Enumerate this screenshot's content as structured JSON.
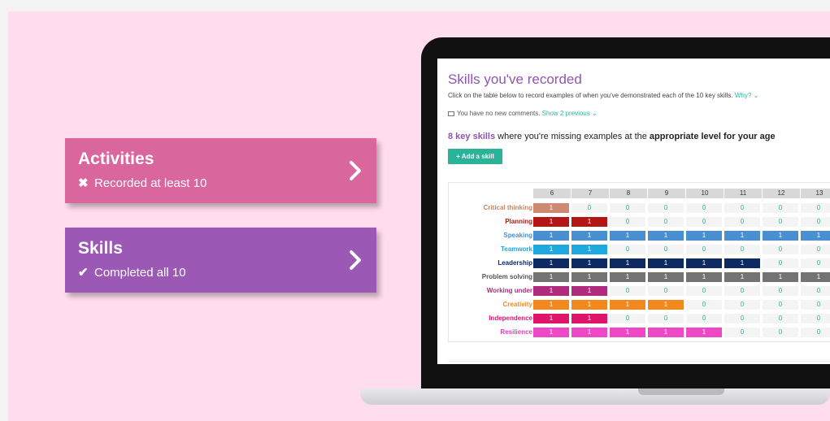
{
  "cards": {
    "activities": {
      "title": "Activities",
      "mark": "✖",
      "subtitle": "Recorded at least 10"
    },
    "skills": {
      "title": "Skills",
      "mark": "✔",
      "subtitle": "Completed all 10"
    }
  },
  "app": {
    "title": "Skills you've recorded",
    "description": "Click on the table below to record examples of when you've demonstrated each of the 10 key skills.",
    "why_link": "Why? ⌄",
    "comments_text": "You have no new comments.",
    "show_previous": "Show 2 previous ⌄",
    "missing_count": "8 key skills",
    "missing_mid": "where you're missing examples at the",
    "missing_bold": "appropriate level for your age",
    "add_button": "+ Add a skill"
  },
  "table": {
    "columns": [
      "6",
      "7",
      "8",
      "9",
      "10",
      "11",
      "12",
      "13"
    ],
    "rows": [
      {
        "label": "Critical thinking",
        "color": "#cc8a72",
        "labelColor": "#c7845f",
        "values": [
          1,
          0,
          0,
          0,
          0,
          0,
          0,
          0
        ]
      },
      {
        "label": "Planning",
        "color": "#b41515",
        "labelColor": "#b41515",
        "values": [
          1,
          1,
          0,
          0,
          0,
          0,
          0,
          0
        ]
      },
      {
        "label": "Speaking",
        "color": "#4a8fd0",
        "labelColor": "#4a8fd0",
        "values": [
          1,
          1,
          1,
          1,
          1,
          1,
          1,
          1
        ]
      },
      {
        "label": "Teamwork",
        "color": "#1fa8e0",
        "labelColor": "#1fa8e0",
        "values": [
          1,
          1,
          0,
          0,
          0,
          0,
          0,
          0
        ]
      },
      {
        "label": "Leadership",
        "color": "#0d2a63",
        "labelColor": "#0d2a63",
        "values": [
          1,
          1,
          1,
          1,
          1,
          1,
          0,
          0
        ]
      },
      {
        "label": "Problem solving",
        "color": "#737373",
        "labelColor": "#555555",
        "values": [
          1,
          1,
          1,
          1,
          1,
          1,
          1,
          1
        ]
      },
      {
        "label": "Working under",
        "color": "#b02a7e",
        "labelColor": "#b02a7e",
        "values": [
          1,
          1,
          0,
          0,
          0,
          0,
          0,
          0
        ]
      },
      {
        "label": "Creativity",
        "color": "#f3891d",
        "labelColor": "#f3891d",
        "values": [
          1,
          1,
          1,
          1,
          0,
          0,
          0,
          0
        ]
      },
      {
        "label": "Independence",
        "color": "#e0146b",
        "labelColor": "#e0146b",
        "values": [
          1,
          1,
          0,
          0,
          0,
          0,
          0,
          0
        ]
      },
      {
        "label": "Resilience",
        "color": "#ef48c7",
        "labelColor": "#e03cc0",
        "values": [
          1,
          1,
          1,
          1,
          1,
          0,
          0,
          0
        ]
      }
    ]
  }
}
